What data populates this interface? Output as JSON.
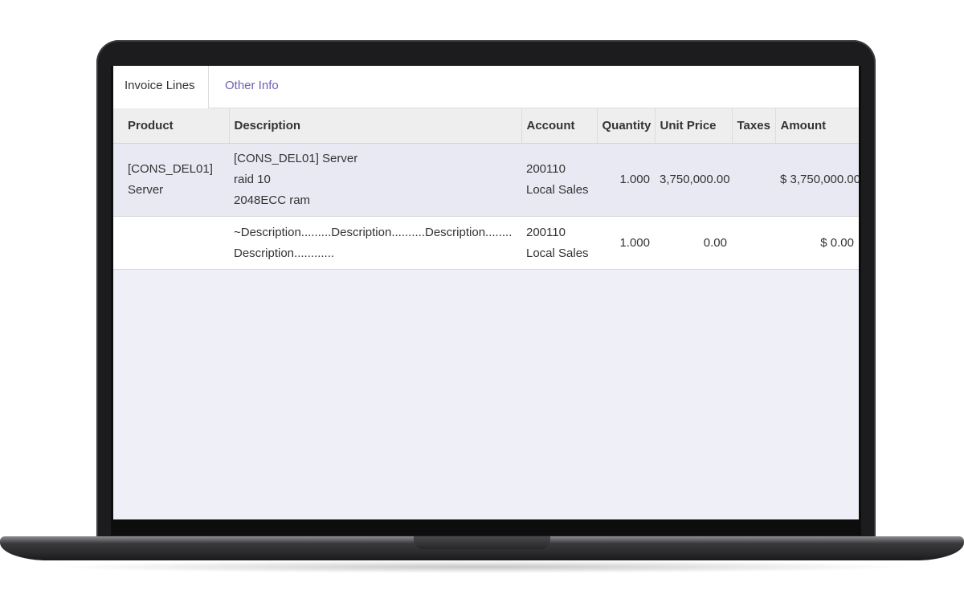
{
  "tabs": {
    "invoice_lines": "Invoice Lines",
    "other_info": "Other Info"
  },
  "table": {
    "headers": {
      "product": "Product",
      "description": "Description",
      "account": "Account",
      "quantity": "Quantity",
      "unit_price": "Unit Price",
      "taxes": "Taxes",
      "amount": "Amount"
    },
    "rows": [
      {
        "product": [
          "[CONS_DEL01]",
          "Server"
        ],
        "description": [
          "[CONS_DEL01] Server",
          "raid 10",
          "2048ECC ram"
        ],
        "account": [
          "200110",
          "Local Sales"
        ],
        "quantity": "1.000",
        "unit_price": "3,750,000.00",
        "taxes": "",
        "amount": "$ 3,750,000.00"
      },
      {
        "product": [],
        "description": [
          "~Description.........Description..........Description........",
          "Description............"
        ],
        "account": [
          "200110",
          "Local Sales"
        ],
        "quantity": "1.000",
        "unit_price": "0.00",
        "taxes": "",
        "amount": "$ 0.00"
      }
    ]
  },
  "colors": {
    "tab_link": "#6b63b5",
    "row_highlight": "#e9e9f4",
    "screen_background": "#efeff7"
  }
}
